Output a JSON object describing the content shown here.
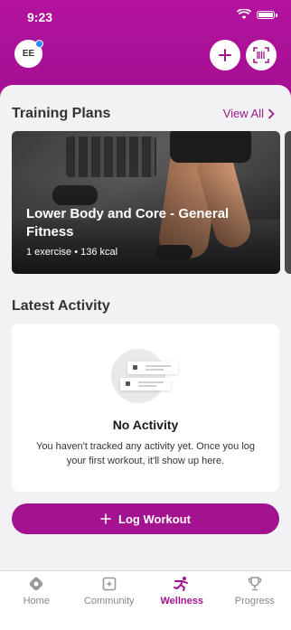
{
  "status": {
    "time": "9:23"
  },
  "header": {
    "avatar_initials": "EE",
    "add_icon": "plus-icon",
    "scan_icon": "barcode-scan-icon"
  },
  "training": {
    "title": "Training Plans",
    "view_all": "View All",
    "plan": {
      "title": "Lower Body and Core - General Fitness",
      "meta": "1 exercise • 136 kcal"
    }
  },
  "activity": {
    "title": "Latest Activity",
    "empty_title": "No Activity",
    "empty_desc": "You haven't tracked any activity yet. Once you log your first workout, it'll show up here."
  },
  "log_button": {
    "label": "Log Workout",
    "icon": "plus-icon"
  },
  "tabs": [
    {
      "label": "Home",
      "icon": "home-icon",
      "active": false
    },
    {
      "label": "Community",
      "icon": "community-icon",
      "active": false
    },
    {
      "label": "Wellness",
      "icon": "wellness-icon",
      "active": true
    },
    {
      "label": "Progress",
      "icon": "trophy-icon",
      "active": false
    }
  ],
  "colors": {
    "brand": "#a3128f",
    "link": "#9c1a8c",
    "background": "#f2f2f4"
  }
}
